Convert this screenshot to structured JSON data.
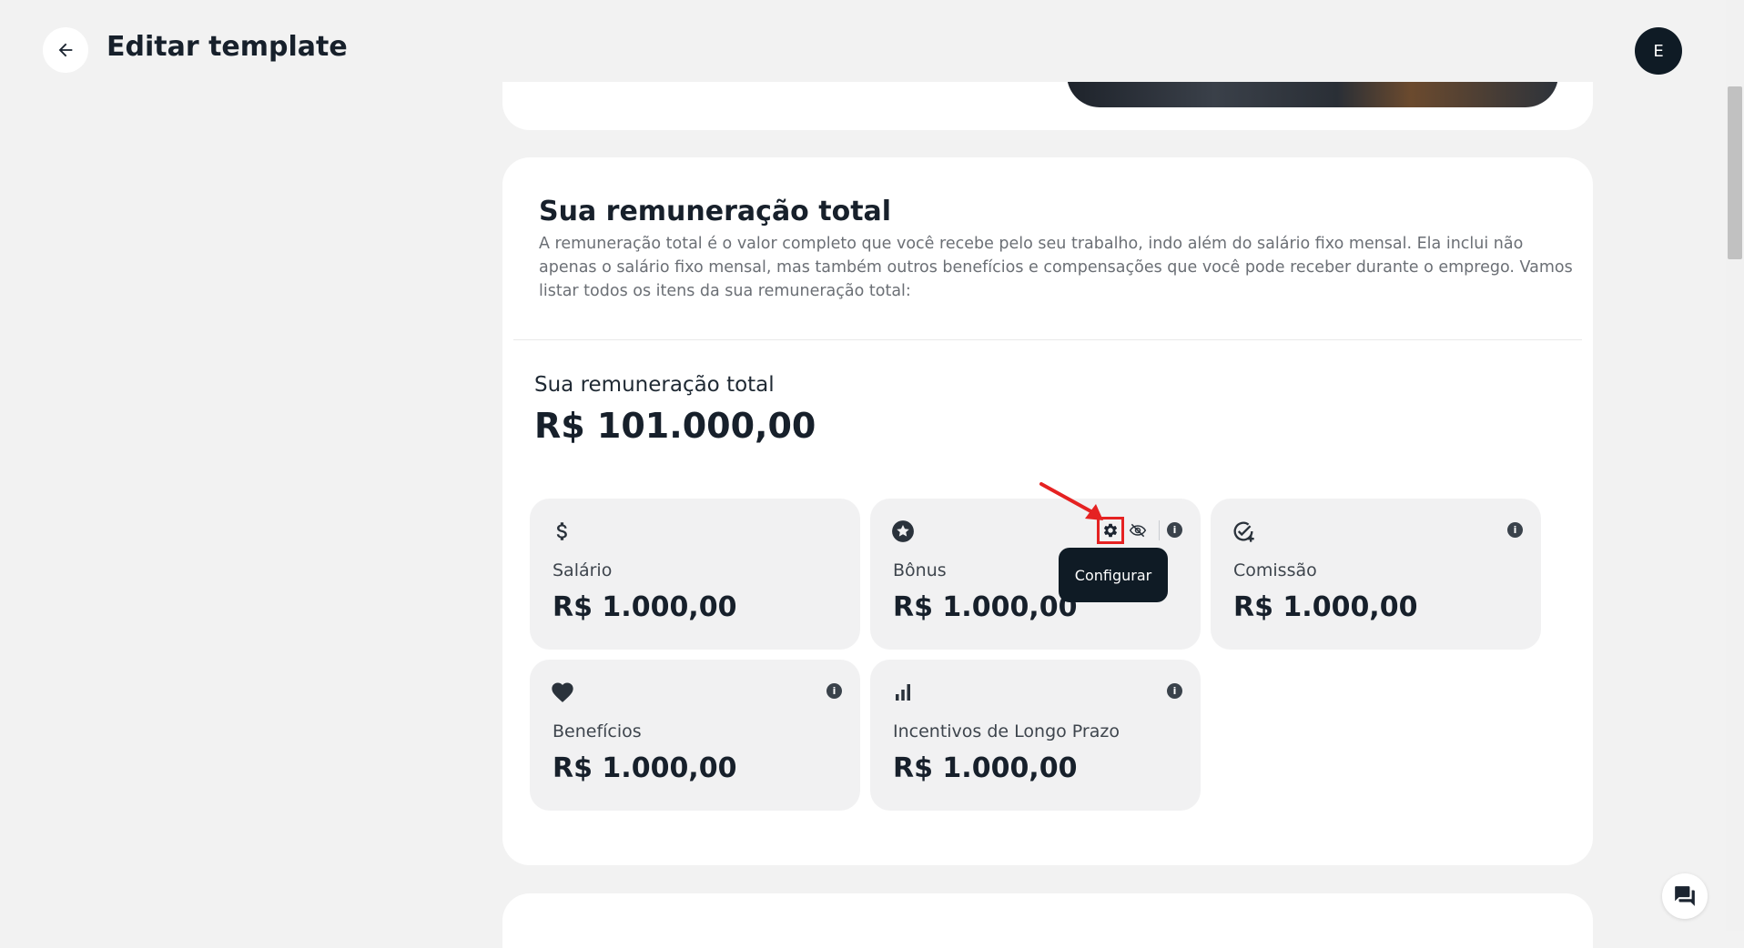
{
  "header": {
    "title": "Editar template",
    "avatar_initial": "E"
  },
  "section": {
    "title": "Sua remuneração total",
    "description": "A remuneração total é o valor completo que você recebe pelo seu trabalho, indo além do salário fixo mensal. Ela inclui não apenas o salário fixo mensal, mas também outros benefícios e compensações que você pode receber durante o emprego. Vamos listar todos os itens da sua remuneração total:",
    "total_label": "Sua remuneração total",
    "total_value": "R$ 101.000,00"
  },
  "items": [
    {
      "name": "Salário",
      "value": "R$ 1.000,00",
      "icon": "dollar-icon"
    },
    {
      "name": "Bônus",
      "value": "R$ 1.000,00",
      "icon": "star-icon"
    },
    {
      "name": "Comissão",
      "value": "R$ 1.000,00",
      "icon": "check-plus-icon"
    },
    {
      "name": "Benefícios",
      "value": "R$ 1.000,00",
      "icon": "heart-icon"
    },
    {
      "name": "Incentivos de Longo Prazo",
      "value": "R$ 1.000,00",
      "icon": "bar-chart-icon"
    }
  ],
  "tooltip": {
    "text": "Configurar"
  },
  "colors": {
    "highlight": "#e52222",
    "dark": "#0f1b25",
    "card_bg": "#f1f1f2"
  }
}
